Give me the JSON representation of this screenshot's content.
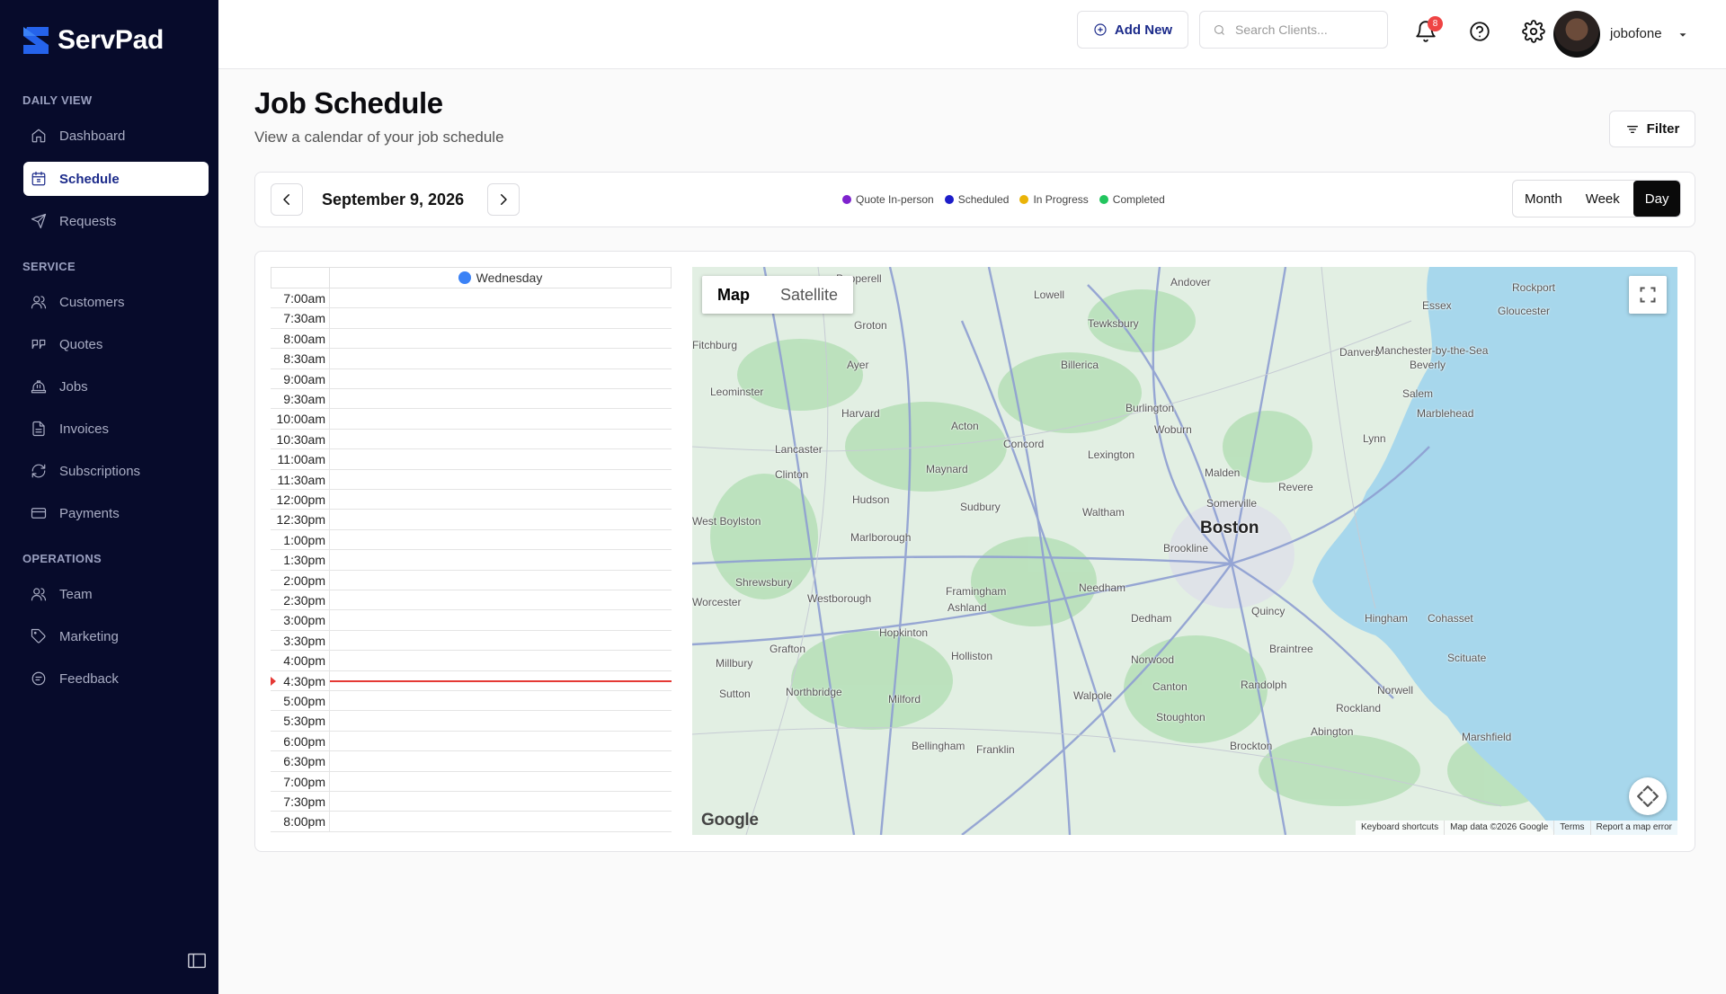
{
  "brand": {
    "name": "ServPad"
  },
  "sidebar": {
    "sections": [
      {
        "title": "DAILY VIEW",
        "items": [
          {
            "label": "Dashboard",
            "icon": "home-icon"
          },
          {
            "label": "Schedule",
            "icon": "calendar-icon",
            "active": true
          },
          {
            "label": "Requests",
            "icon": "send-icon"
          }
        ]
      },
      {
        "title": "SERVICE",
        "items": [
          {
            "label": "Customers",
            "icon": "users-icon"
          },
          {
            "label": "Quotes",
            "icon": "quote-icon"
          },
          {
            "label": "Jobs",
            "icon": "hardhat-icon"
          },
          {
            "label": "Invoices",
            "icon": "document-icon"
          },
          {
            "label": "Subscriptions",
            "icon": "refresh-icon"
          },
          {
            "label": "Payments",
            "icon": "credit-card-icon"
          }
        ]
      },
      {
        "title": "OPERATIONS",
        "items": [
          {
            "label": "Team",
            "icon": "users-icon"
          },
          {
            "label": "Marketing",
            "icon": "tag-icon"
          },
          {
            "label": "Feedback",
            "icon": "message-icon"
          }
        ]
      }
    ]
  },
  "topbar": {
    "add_new_label": "Add New",
    "search_placeholder": "Search Clients...",
    "notification_count": "8",
    "username": "jobofone"
  },
  "page": {
    "title": "Job Schedule",
    "subtitle": "View a calendar of your job schedule",
    "filter_label": "Filter"
  },
  "toolbar": {
    "current_date": "September 9, 2026",
    "legend": [
      {
        "label": "Quote In-person",
        "color": "#7e22ce"
      },
      {
        "label": "Scheduled",
        "color": "#1d1dc9"
      },
      {
        "label": "In Progress",
        "color": "#eab308"
      },
      {
        "label": "Completed",
        "color": "#22c55e"
      }
    ],
    "views": [
      "Month",
      "Week",
      "Day"
    ],
    "active_view": "Day"
  },
  "schedule": {
    "day_label": "Wednesday",
    "times": [
      "7:00am",
      "7:30am",
      "8:00am",
      "8:30am",
      "9:00am",
      "9:30am",
      "10:00am",
      "10:30am",
      "11:00am",
      "11:30am",
      "12:00pm",
      "12:30pm",
      "1:00pm",
      "1:30pm",
      "2:00pm",
      "2:30pm",
      "3:00pm",
      "3:30pm",
      "4:00pm",
      "4:30pm",
      "5:00pm",
      "5:30pm",
      "6:00pm",
      "6:30pm",
      "7:00pm",
      "7:30pm",
      "8:00pm"
    ],
    "current_time_slot": "4:30pm"
  },
  "map": {
    "types": [
      "Map",
      "Satellite"
    ],
    "active_type": "Map",
    "logo": "Google",
    "footer": [
      "Keyboard shortcuts",
      "Map data ©2026 Google",
      "Terms",
      "Report a map error"
    ],
    "places": [
      "Pepperell",
      "Andover",
      "Rockport",
      "Lowell",
      "Essex",
      "Gloucester",
      "Groton",
      "Tewksbury",
      "Fitchburg",
      "Danvers",
      "Manchester-by-the-Sea",
      "Ayer",
      "Billerica",
      "Beverly",
      "Leominster",
      "Harvard",
      "Burlington",
      "Salem",
      "Acton",
      "Woburn",
      "Marblehead",
      "Lynn",
      "Lancaster",
      "Concord",
      "Lexington",
      "Clinton",
      "Maynard",
      "Malden",
      "Revere",
      "Hudson",
      "Sudbury",
      "Waltham",
      "Somerville",
      "Boston",
      "West Boylston",
      "Marlborough",
      "Brookline",
      "Shrewsbury",
      "Framingham",
      "Needham",
      "Westborough",
      "Ashland",
      "Worcester",
      "Quincy",
      "Hingham",
      "Cohasset",
      "Dedham",
      "Hopkinton",
      "Grafton",
      "Braintree",
      "Scituate",
      "Holliston",
      "Norwood",
      "Millbury",
      "Canton",
      "Randolph",
      "Sutton",
      "Northbridge",
      "Milford",
      "Walpole",
      "Norwell",
      "Stoughton",
      "Rockland",
      "Abington",
      "Bellingham",
      "Franklin",
      "Brockton",
      "Marshfield"
    ]
  }
}
